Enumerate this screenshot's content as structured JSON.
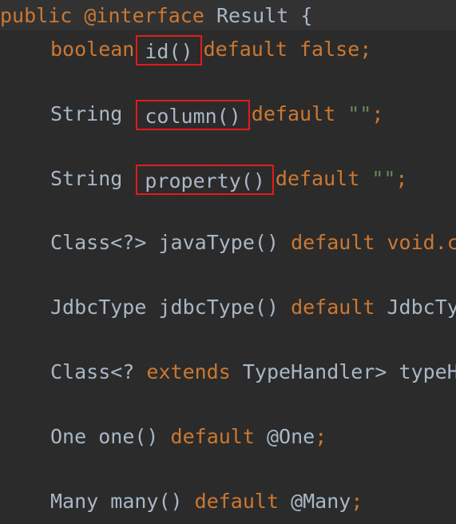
{
  "code": {
    "header": {
      "kw_public": "public",
      "kw_interface": "@interface",
      "name": "Result",
      "brace": "{"
    },
    "line_id": {
      "type": "boolean",
      "method": "id()",
      "kw_default": "default",
      "value": "false",
      "end": ";"
    },
    "line_column": {
      "type": "String",
      "method": "column()",
      "kw_default": "default",
      "value": "\"\"",
      "end": ";"
    },
    "line_property": {
      "type": "String",
      "method": "property()",
      "kw_default": "default",
      "value": "\"\"",
      "end": ";"
    },
    "line_javatype": {
      "type": "Class<?>",
      "method": "javaType()",
      "kw_default": "default",
      "value": "void.c"
    },
    "line_jdbctype": {
      "type": "JdbcType",
      "method": "jdbcType()",
      "kw_default": "default",
      "value": "JdbcTy"
    },
    "line_typehandler": {
      "type_start": "Class<?",
      "kw_extends": "extends",
      "type_end": "TypeHandler>",
      "method": "typeH"
    },
    "line_one": {
      "type": "One",
      "method": "one()",
      "kw_default": "default",
      "value": "@One",
      "end": ";"
    },
    "line_many": {
      "type": "Many",
      "method": "many()",
      "kw_default": "default",
      "value": "@Many",
      "end": ";"
    }
  },
  "colors": {
    "background": "#2b2b2b",
    "keyword": "#cc7832",
    "identifier": "#a9b7c6",
    "string": "#6a8759",
    "highlight_box": "#e31b1b"
  }
}
